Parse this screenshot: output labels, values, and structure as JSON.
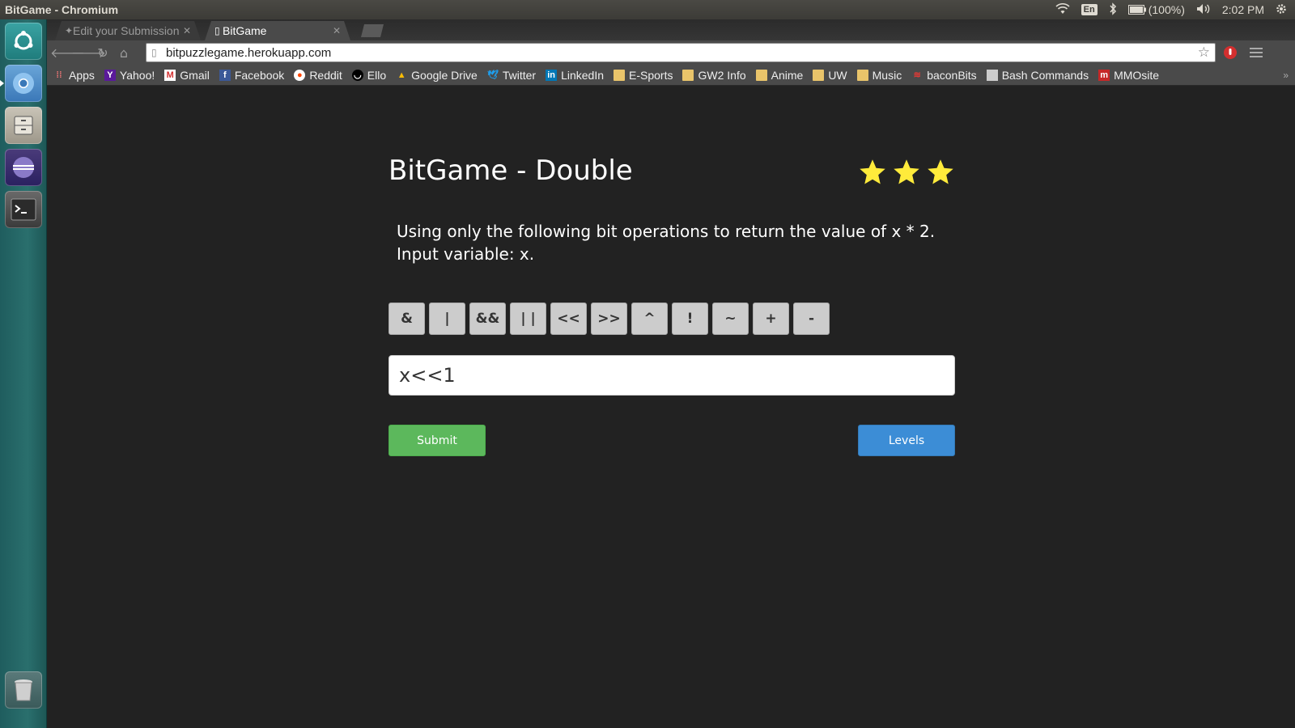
{
  "window": {
    "title": "BitGame - Chromium"
  },
  "panel": {
    "lang": "En",
    "battery": "(100%)",
    "time": "2:02 PM"
  },
  "tabs": [
    {
      "label": "Edit your Submission",
      "active": false
    },
    {
      "label": "BitGame",
      "active": true
    }
  ],
  "address_bar": {
    "url": "bitpuzzlegame.herokuapp.com"
  },
  "bookmarks": [
    {
      "label": "Apps",
      "icon": "apps-grid-icon"
    },
    {
      "label": "Yahoo!",
      "icon": "yahoo-icon"
    },
    {
      "label": "Gmail",
      "icon": "gmail-icon"
    },
    {
      "label": "Facebook",
      "icon": "facebook-icon"
    },
    {
      "label": "Reddit",
      "icon": "reddit-icon"
    },
    {
      "label": "Ello",
      "icon": "ello-icon"
    },
    {
      "label": "Google Drive",
      "icon": "google-drive-icon"
    },
    {
      "label": "Twitter",
      "icon": "twitter-icon"
    },
    {
      "label": "LinkedIn",
      "icon": "linkedin-icon"
    },
    {
      "label": "E-Sports",
      "icon": "folder-icon"
    },
    {
      "label": "GW2 Info",
      "icon": "folder-icon"
    },
    {
      "label": "Anime",
      "icon": "folder-icon"
    },
    {
      "label": "UW",
      "icon": "folder-icon"
    },
    {
      "label": "Music",
      "icon": "folder-icon"
    },
    {
      "label": "baconBits",
      "icon": "baconbits-icon"
    },
    {
      "label": "Bash Commands",
      "icon": "page-icon"
    },
    {
      "label": "MMOsite",
      "icon": "mmosite-icon"
    }
  ],
  "game": {
    "title": "BitGame - Double",
    "rating": {
      "stars": 3,
      "max": 3,
      "color": "#ffeb3b"
    },
    "description": "Using only the following bit operations to return the value of x * 2. Input variable: x.",
    "operators": [
      "&",
      "|",
      "&&",
      "| |",
      "<<",
      ">>",
      "^",
      "!",
      "~",
      "+",
      "-"
    ],
    "expression": "x<<1",
    "submit_label": "Submit",
    "levels_label": "Levels"
  },
  "colors": {
    "submit": "#5cb85c",
    "levels": "#3c8dd6",
    "background": "#222222"
  }
}
